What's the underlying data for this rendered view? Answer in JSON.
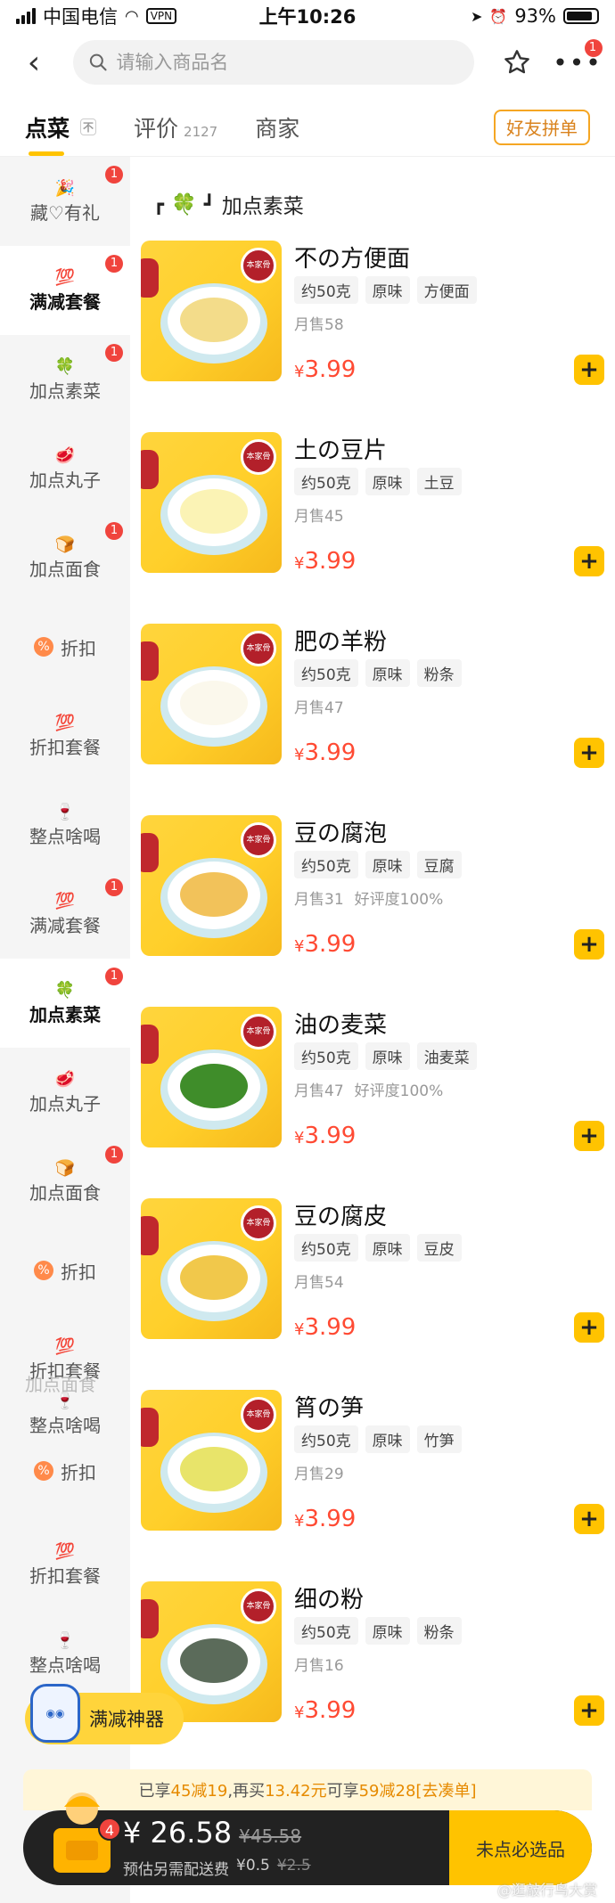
{
  "status_bar": {
    "carrier": "中国电信",
    "vpn": "VPN",
    "time": "上午10:26",
    "battery": "93%"
  },
  "top_bar": {
    "search_placeholder": "请输入商品名",
    "notification_count": "1"
  },
  "tabs": [
    {
      "label": "点菜",
      "active": true
    },
    {
      "label": "评价",
      "count": "2127",
      "active": false
    },
    {
      "label": "商家",
      "active": false
    }
  ],
  "tabs_pin": "不",
  "group_order_label": "好友拼单",
  "sidebar": {
    "items": [
      {
        "icon": "🎉",
        "label": "藏♡有礼",
        "badge": "1"
      },
      {
        "icon": "💯",
        "label": "满减套餐",
        "badge": "1",
        "active": true
      },
      {
        "icon": "🍀",
        "label": "加点素菜",
        "badge": "1"
      },
      {
        "icon": "🥩",
        "label": "加点丸子",
        "badge": ""
      },
      {
        "icon": "🍞",
        "label": "加点面食",
        "badge": "1"
      },
      {
        "icon": "%",
        "label": "折扣",
        "badge": ""
      },
      {
        "icon": "💯",
        "label": "折扣套餐",
        "badge": ""
      },
      {
        "icon": "🍷",
        "label": "整点啥喝",
        "badge": ""
      },
      {
        "icon": "💯",
        "label": "满减套餐",
        "badge": "1"
      },
      {
        "icon": "🍀",
        "label": "加点素菜",
        "badge": "1",
        "active": true
      },
      {
        "icon": "🥩",
        "label": "加点丸子",
        "badge": ""
      },
      {
        "icon": "🍞",
        "label": "加点面食",
        "badge": "1"
      },
      {
        "icon": "%",
        "label": "折扣",
        "badge": ""
      },
      {
        "icon": "💯",
        "label": "折扣套餐",
        "badge": ""
      },
      {
        "icon": "🍷",
        "label": "整点啥喝",
        "badge": ""
      },
      {
        "icon": "%",
        "label": "折扣",
        "badge": ""
      },
      {
        "icon": "💯",
        "label": "折扣套餐",
        "badge": ""
      },
      {
        "icon": "🍷",
        "label": "整点啥喝",
        "badge": ""
      }
    ],
    "ghost_label": "加点面食"
  },
  "section": {
    "icon": "🍀",
    "title": "加点素菜"
  },
  "dishes": [
    {
      "name": "不の方便面",
      "tags": [
        "约50克",
        "原味",
        "方便面"
      ],
      "sales": "月售58",
      "rating": "",
      "price": "3.99",
      "food_color": "#f3dc8a"
    },
    {
      "name": "土の豆片",
      "tags": [
        "约50克",
        "原味",
        "土豆"
      ],
      "sales": "月售45",
      "rating": "",
      "price": "3.99",
      "food_color": "#fbf3b5"
    },
    {
      "name": "肥の羊粉",
      "tags": [
        "约50克",
        "原味",
        "粉条"
      ],
      "sales": "月售47",
      "rating": "",
      "price": "3.99",
      "food_color": "#fbf8ec"
    },
    {
      "name": "豆の腐泡",
      "tags": [
        "约50克",
        "原味",
        "豆腐"
      ],
      "sales": "月售31",
      "rating": "好评度100%",
      "price": "3.99",
      "food_color": "#f2c25a"
    },
    {
      "name": "油の麦菜",
      "tags": [
        "约50克",
        "原味",
        "油麦菜"
      ],
      "sales": "月售47",
      "rating": "好评度100%",
      "price": "3.99",
      "food_color": "#3f8d2a"
    },
    {
      "name": "豆の腐皮",
      "tags": [
        "约50克",
        "原味",
        "豆皮"
      ],
      "sales": "月售54",
      "rating": "",
      "price": "3.99",
      "food_color": "#f1c84b"
    },
    {
      "name": "筲の笋",
      "tags": [
        "约50克",
        "原味",
        "竹笋"
      ],
      "sales": "月售29",
      "rating": "",
      "price": "3.99",
      "food_color": "#e8e46a"
    },
    {
      "name": "细の粉",
      "tags": [
        "约50克",
        "原味",
        "粉条"
      ],
      "sales": "月售16",
      "rating": "",
      "price": "3.99",
      "food_color": "#5b6b5a"
    }
  ],
  "dish_logo_text": "本家骨",
  "price_currency": "¥",
  "promo_float": {
    "label": "满减神器"
  },
  "discount_strip": {
    "prefix": "已享",
    "current_discount": "45减19",
    "middle": ",再买",
    "amount_needed": "13.42元",
    "middle2": "可享",
    "next_discount": "59减28",
    "action": "[去凑单]"
  },
  "cart": {
    "count": "4",
    "total": "¥ 26.58",
    "original_total": "¥45.58",
    "delivery_label": "预估另需配送费",
    "delivery_fee": "¥0.5",
    "delivery_original": "¥2.5",
    "checkout_label": "未点必选品"
  },
  "watermark": "@逛敲行鸟大赏",
  "colors": {
    "accent_yellow": "#ffc300",
    "price_red": "#ff4a33",
    "badge_red": "#f0443d",
    "discount_orange": "#e68a00"
  }
}
